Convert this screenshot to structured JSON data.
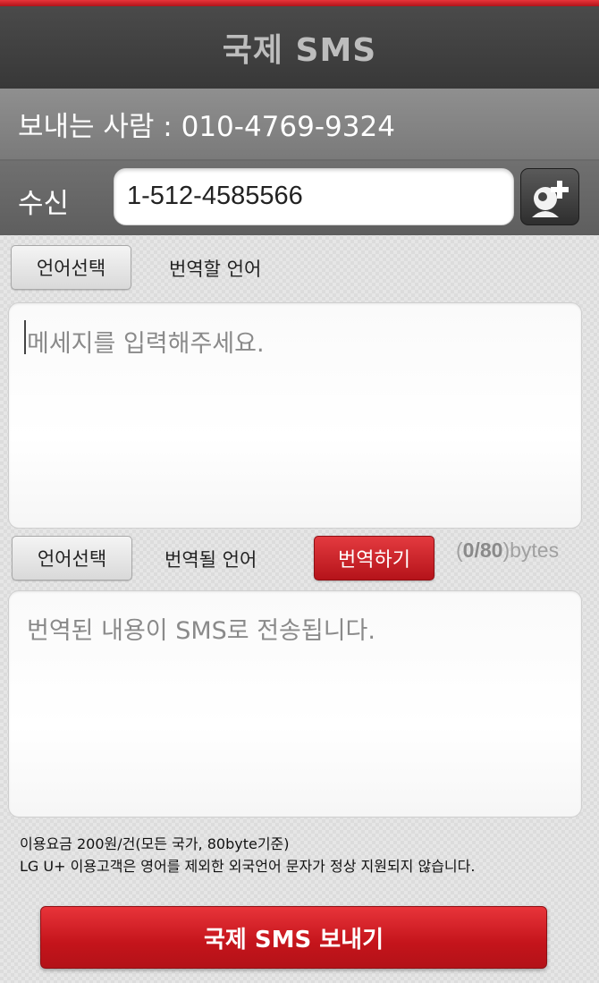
{
  "app": {
    "title": "국제 SMS"
  },
  "sender": {
    "text": "보내는 사람 : 010-4769-9324"
  },
  "recipient": {
    "label": "수신",
    "number": "1-512-4585566",
    "contact_icon": "add-contact-icon"
  },
  "source": {
    "lang_button": "언어선택",
    "lang_label": "번역할 언어",
    "placeholder": "메세지를 입력해주세요."
  },
  "target": {
    "lang_button": "언어선택",
    "lang_label": "번역될 언어",
    "translate_button": "번역하기",
    "byte_open": "(",
    "byte_count": "0/80",
    "byte_close": ")bytes",
    "placeholder": "번역된 내용이 SMS로 전송됩니다."
  },
  "notice": {
    "line1": "이용요금 200원/건(모든 국가, 80byte기준)",
    "line2": "LG U+ 이용고객은 영어를 제외한 외국언어 문자가 정상 지원되지 않습니다."
  },
  "send_button": "국제 SMS 보내기",
  "colors": {
    "accent": "#c4141b",
    "header": "#3f3f3f"
  }
}
